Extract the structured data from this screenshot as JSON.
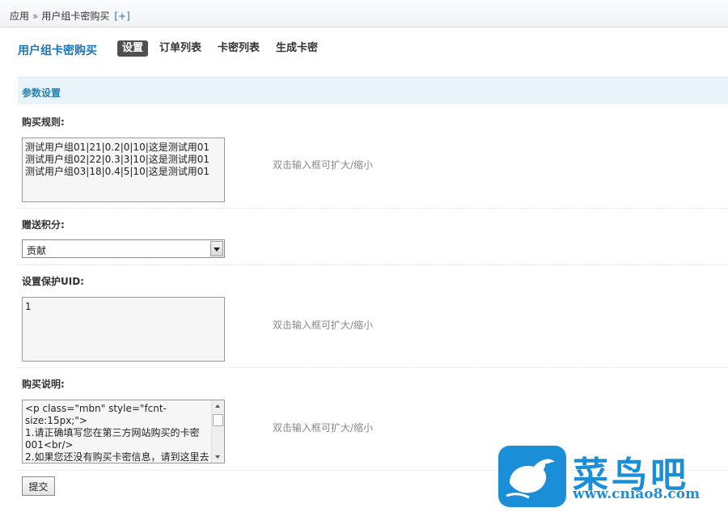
{
  "breadcrumb": {
    "root": "应用",
    "separator": "»",
    "current": "用户组卡密购买",
    "add_label": "[+]"
  },
  "header": {
    "app_title": "用户组卡密购买",
    "tabs": [
      {
        "label": "设置",
        "active": true
      },
      {
        "label": "订单列表",
        "active": false
      },
      {
        "label": "卡密列表",
        "active": false
      },
      {
        "label": "生成卡密",
        "active": false
      }
    ]
  },
  "section": {
    "title": "参数设置"
  },
  "form": {
    "purchase_rules": {
      "label": "购买规则:",
      "value": "测试用户组01|21|0.2|0|10|这是测试用01\n测试用户组02|22|0.3|3|10|这是测试用01\n测试用户组03|18|0.4|5|10|这是测试用01",
      "hint": "双击输入框可扩大/缩小"
    },
    "bonus_credit": {
      "label": "赠送积分:",
      "selected": "贡献"
    },
    "protect_uid": {
      "label": "设置保护UID:",
      "value": "1",
      "hint": "双击输入框可扩大/缩小"
    },
    "purchase_desc": {
      "label": "购买说明:",
      "value": "<p class=\"mbn\" style=\"fcnt-\nsize:15px;\">\n1.请正确填写您在第三方网站购买的卡密\n001<br/>\n2.如果您还没有购买卡密信息，请到这里去",
      "hint": "双击输入框可扩大/缩小"
    },
    "submit_label": "提交"
  },
  "watermark": {
    "brand_text": "菜鸟吧",
    "url": "www.cniao8.com"
  },
  "colors": {
    "accent": "#1a75bb",
    "section_bg": "#e9f4fa",
    "watermark": "#1a8fd8"
  }
}
